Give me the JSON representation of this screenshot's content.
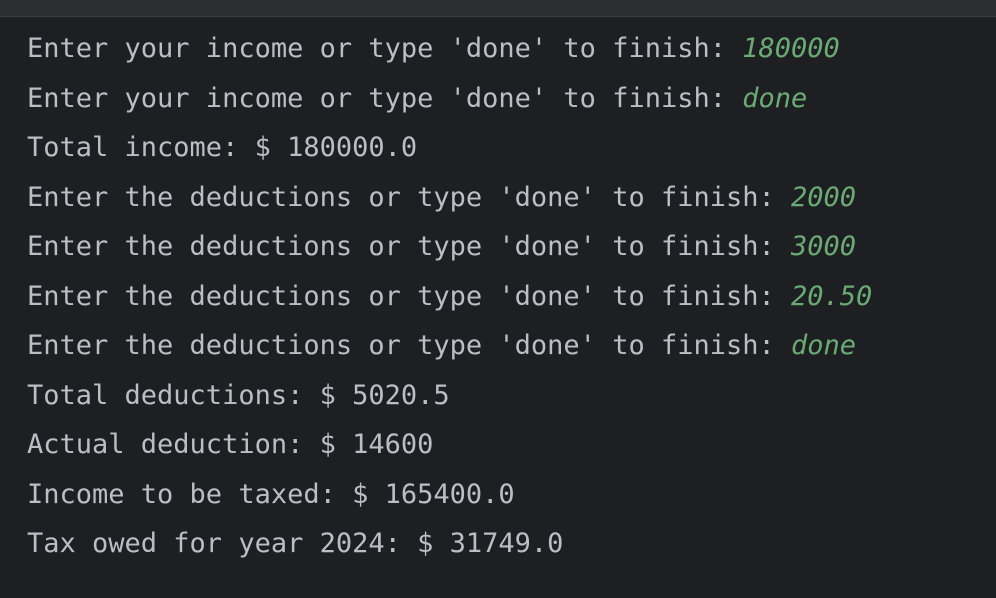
{
  "console": {
    "lines": [
      {
        "prompt": "Enter your income or type 'done' to finish: ",
        "input": "180000"
      },
      {
        "prompt": "Enter your income or type 'done' to finish: ",
        "input": "done"
      },
      {
        "prompt": "Total income: $ 180000.0",
        "input": ""
      },
      {
        "prompt": "Enter the deductions or type 'done' to finish: ",
        "input": "2000"
      },
      {
        "prompt": "Enter the deductions or type 'done' to finish: ",
        "input": "3000"
      },
      {
        "prompt": "Enter the deductions or type 'done' to finish: ",
        "input": "20.50"
      },
      {
        "prompt": "Enter the deductions or type 'done' to finish: ",
        "input": "done"
      },
      {
        "prompt": "Total deductions: $ 5020.5",
        "input": ""
      },
      {
        "prompt": "Actual deduction: $ 14600",
        "input": ""
      },
      {
        "prompt": "Income to be taxed: $ 165400.0",
        "input": ""
      },
      {
        "prompt": "Tax owed for year 2024: $ 31749.0",
        "input": ""
      }
    ]
  },
  "colors": {
    "background": "#1e1f22",
    "output_text": "#bcbec4",
    "user_input": "#6aab73"
  }
}
